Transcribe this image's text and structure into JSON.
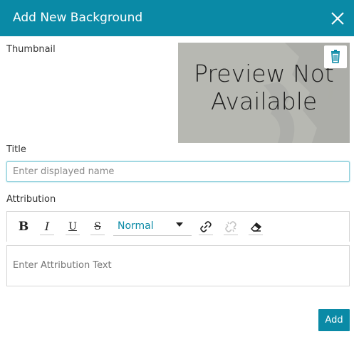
{
  "dialog": {
    "title": "Add New Background",
    "close_icon": "close-icon"
  },
  "thumbnail": {
    "label": "Thumbnail",
    "preview_line1": "Preview Not",
    "preview_line2": "Available",
    "delete_icon": "trash-icon"
  },
  "title_field": {
    "label": "Title",
    "placeholder": "Enter displayed name",
    "value": ""
  },
  "attribution": {
    "label": "Attribution",
    "toolbar": {
      "bold": "B",
      "italic": "I",
      "underline": "U",
      "strike": "S",
      "format_value": "Normal",
      "link_icon": "link-icon",
      "unlink_icon": "unlink-icon",
      "clear_icon": "eraser-icon"
    },
    "placeholder": "Enter Attribution Text"
  },
  "actions": {
    "add_label": "Add"
  },
  "colors": {
    "accent": "#0a8aa6",
    "text": "#333333",
    "border": "#d6d6d6"
  }
}
